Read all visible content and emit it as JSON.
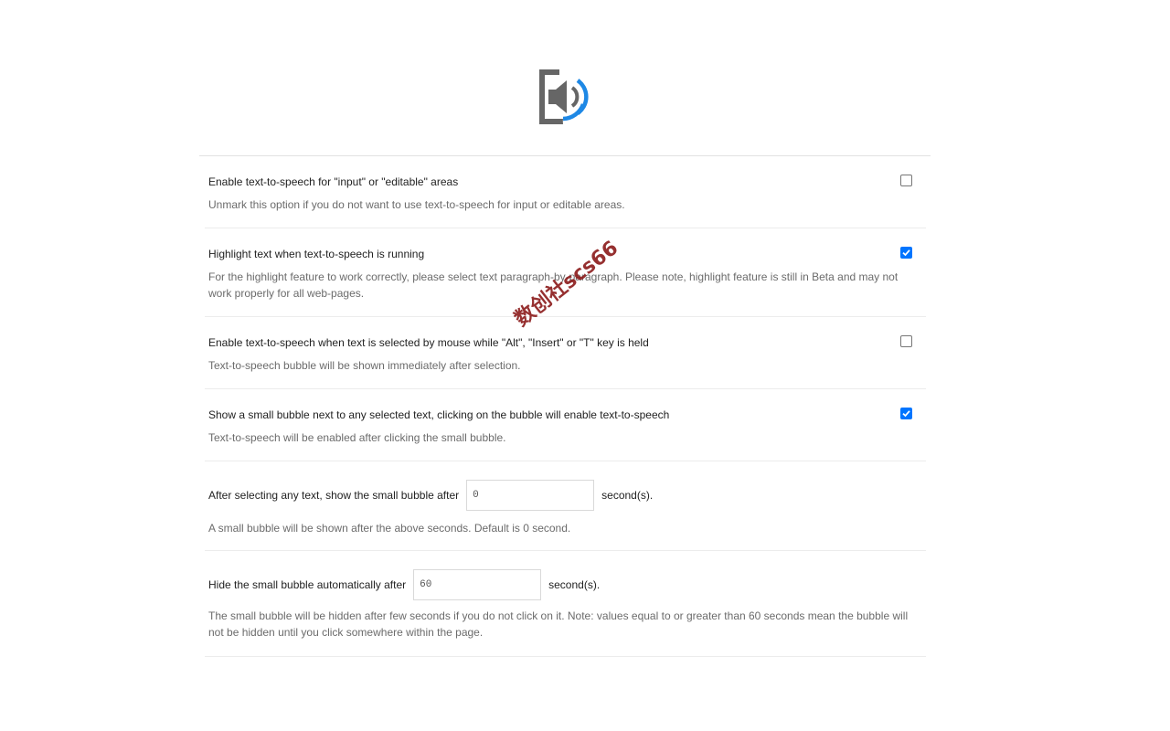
{
  "logo": {
    "icon": "speaker-volume-icon",
    "colors": {
      "frame": "#666666",
      "waves": "#1e88e5"
    }
  },
  "options": [
    {
      "title": "Enable text-to-speech for \"input\" or \"editable\" areas",
      "description": "Unmark this option if you do not want to use text-to-speech for input or editable areas.",
      "checked": false
    },
    {
      "title": "Highlight text when text-to-speech is running",
      "description": "For the highlight feature to work correctly, please select text paragraph-by-paragraph. Please note, highlight feature is still in Beta and may not work properly for all web-pages.",
      "checked": true
    },
    {
      "title": "Enable text-to-speech when text is selected by mouse while \"Alt\", \"Insert\" or \"T\" key is held",
      "description": "Text-to-speech bubble will be shown immediately after selection.",
      "checked": false
    },
    {
      "title": "Show a small bubble next to any selected text, clicking on the bubble will enable text-to-speech",
      "description": "Text-to-speech will be enabled after clicking the small bubble.",
      "checked": true
    }
  ],
  "delay_setting": {
    "label": "After selecting any text, show the small bubble after",
    "value": "0",
    "unit": "second(s).",
    "description": "A small bubble will be shown after the above seconds. Default is 0 second."
  },
  "hide_setting": {
    "label": "Hide the small bubble automatically after",
    "value": "60",
    "unit": "second(s).",
    "description": "The small bubble will be hidden after few seconds if you do not click on it. Note: values equal to or greater than 60 seconds mean the bubble will not be hidden until you click somewhere within the page."
  },
  "watermark": "数创社scs66",
  "accent_color": "#0075ff"
}
